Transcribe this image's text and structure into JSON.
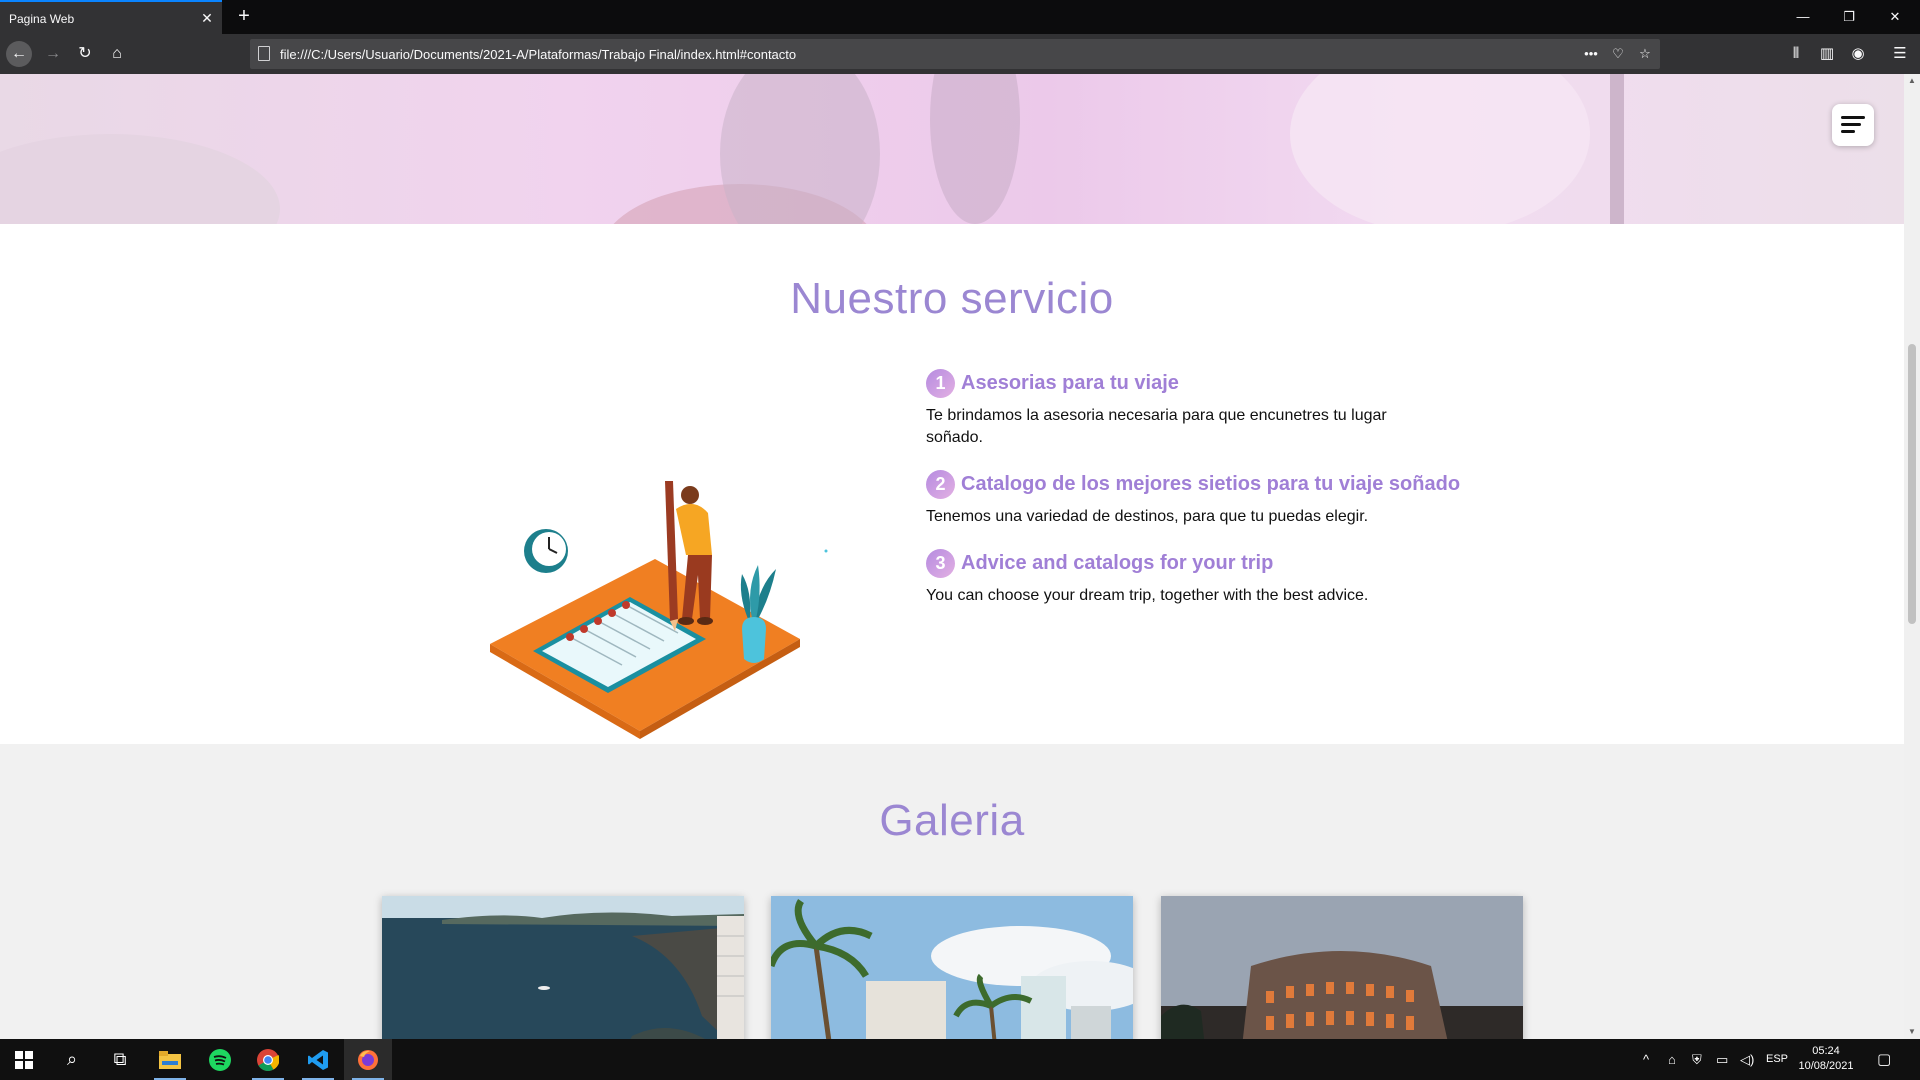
{
  "browser": {
    "tab_title": "Pagina Web",
    "url": "file:///C:/Users/Usuario/Documents/2021-A/Plataformas/Trabajo Final/index.html#contacto"
  },
  "page": {
    "service": {
      "title": "Nuestro servicio",
      "items": [
        {
          "number": "1",
          "title": "Asesorias para tu viaje",
          "description": "Te brindamos la asesoria necesaria para que encunetres tu lugar soñado."
        },
        {
          "number": "2",
          "title": "Catalogo de los mejores sietios para tu viaje soñado",
          "description": "Tenemos una variedad de destinos, para que tu puedas elegir."
        },
        {
          "number": "3",
          "title": "Advice and catalogs for your trip",
          "description": "You can choose your dream trip, together with the best advice."
        }
      ]
    },
    "gallery": {
      "title": "Galeria"
    }
  },
  "taskbar": {
    "language": "ESP",
    "time": "05:24",
    "date": "10/08/2021"
  },
  "colors": {
    "accent": "#9b87d2",
    "browser_chrome": "#323234",
    "taskbar": "#101010"
  }
}
